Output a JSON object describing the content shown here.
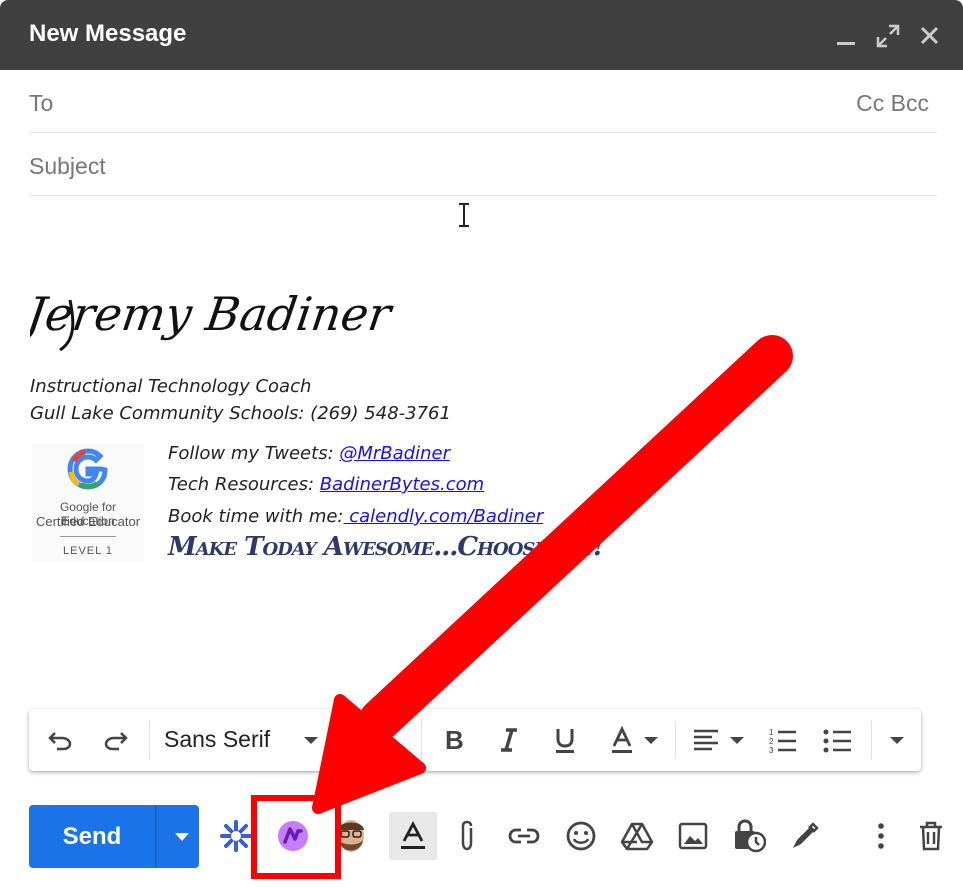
{
  "window": {
    "title": "New Message",
    "controls": [
      "minimize-icon",
      "expand-icon",
      "close-icon"
    ]
  },
  "fields": {
    "to_label": "To",
    "cc_bcc": "Cc Bcc",
    "subject_placeholder": "Subject"
  },
  "signature": {
    "name": "Jeremy Badiner",
    "title": "Instructional Technology Coach",
    "org_phone": "Gull Lake Community Schools: (269) 548-3761",
    "badge": {
      "line1": "Google for Education",
      "line2": "Certified Educator",
      "line3": "LEVEL 1"
    },
    "tweets_label": "Follow my Tweets: ",
    "tweets_link": "@MrBadiner",
    "resources_label": "Tech Resources: ",
    "resources_link": "BadinerBytes.com",
    "book_label": "Book time with me:",
    "book_link": " calendly.com/Badiner",
    "motto": "Make Today Awesome...Choose Joy!"
  },
  "format_bar": {
    "font": "Sans Serif",
    "tools": [
      "undo-icon",
      "redo-icon",
      "font-select",
      "font-size-icon",
      "bold-icon",
      "italic-icon",
      "underline-icon",
      "text-color-icon",
      "align-icon",
      "numbered-list-icon",
      "bulleted-list-icon",
      "more-formatting-icon"
    ]
  },
  "bottom_toolbar": {
    "send_label": "Send",
    "tools": [
      "addon-sparkle-icon",
      "addon-purple-icon",
      "bitmoji-icon",
      "formatting-options-icon",
      "attach-icon",
      "link-icon",
      "emoji-icon",
      "drive-icon",
      "photo-icon",
      "confidential-icon",
      "signature-icon",
      "more-options-icon",
      "discard-icon"
    ]
  },
  "colors": {
    "titlebar": "#404040",
    "send": "#1a73e8",
    "annotation": "#ff0000",
    "link": "#1a0dff"
  }
}
